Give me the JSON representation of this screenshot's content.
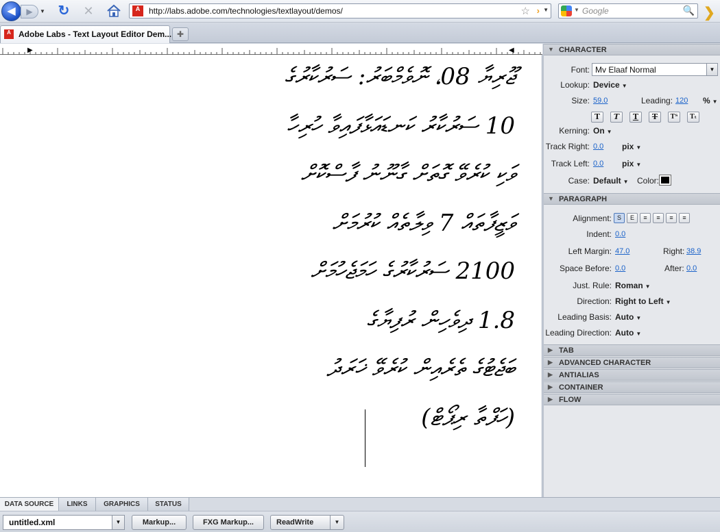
{
  "browser": {
    "url": "http://labs.adobe.com/technologies/textlayout/demos/",
    "search_placeholder": "Google",
    "tab_title": "Adobe Labs - Text Layout Editor Dem...",
    "favicon_text": "Adobe"
  },
  "editor": {
    "lines": [
      "ޖޫރިޔާ 08، ނޮވެމްބަރު: ސަރުކާރުގެ",
      "10 ސަރުކާރު ކަނޑައަޅާފައިވާ ހުރިހާ",
      "ވަކި ކުރެވޭ ގޮތަށް ގާނޫނު ފާސްކޮށް",
      "ވަޒީފާތައް 7 ވިލާތެއް ކުރުމަށް",
      "2100 ސަރުކާރުގެ ހަމަޖެހުމަށް",
      "1.8 ދިވެހިން ރުފިޔާގެ",
      "ބަޖެޓުގެ ތެރެއިން ކުރެވޭ ޚަރަދު",
      "(ހަފްތާ ރިޕޯޓް)"
    ]
  },
  "panel": {
    "character": {
      "header": "CHARACTER",
      "font_label": "Font:",
      "font_value": "Mv Elaaf Normal",
      "lookup_label": "Lookup:",
      "lookup_value": "Device",
      "size_label": "Size:",
      "size_value": "59.0",
      "leading_label": "Leading:",
      "leading_value": "120",
      "leading_unit": "%",
      "format_buttons": [
        "T",
        "T",
        "T",
        "T",
        "Tᵀ",
        "Tₜ"
      ],
      "kerning_label": "Kerning:",
      "kerning_value": "On",
      "track_right_label": "Track Right:",
      "track_right_value": "0.0",
      "track_right_unit": "pix",
      "track_left_label": "Track Left:",
      "track_left_value": "0.0",
      "track_left_unit": "pix",
      "case_label": "Case:",
      "case_value": "Default",
      "color_label": "Color:",
      "color_value": "#000000"
    },
    "paragraph": {
      "header": "PARAGRAPH",
      "alignment_label": "Alignment:",
      "alignment_buttons": [
        "S",
        "E",
        "≡",
        "≡",
        "≡",
        "≡"
      ],
      "indent_label": "Indent:",
      "indent_value": "0.0",
      "left_margin_label": "Left Margin:",
      "left_margin_value": "47.0",
      "right_label": "Right:",
      "right_value": "38.9",
      "space_before_label": "Space Before:",
      "space_before_value": "0.0",
      "after_label": "After:",
      "after_value": "0.0",
      "just_rule_label": "Just. Rule:",
      "just_rule_value": "Roman",
      "direction_label": "Direction:",
      "direction_value": "Right to Left",
      "leading_basis_label": "Leading Basis:",
      "leading_basis_value": "Auto",
      "leading_direction_label": "Leading Direction:",
      "leading_direction_value": "Auto"
    },
    "collapsed_sections": [
      "TAB",
      "ADVANCED CHARACTER",
      "ANTIALIAS",
      "CONTAINER",
      "FLOW"
    ]
  },
  "bottom": {
    "tabs": [
      "DATA SOURCE",
      "LINKS",
      "GRAPHICS",
      "STATUS"
    ],
    "file_value": "untitled.xml",
    "markup_label": "Markup...",
    "fxg_label": "FXG Markup...",
    "mode_value": "ReadWrite"
  }
}
